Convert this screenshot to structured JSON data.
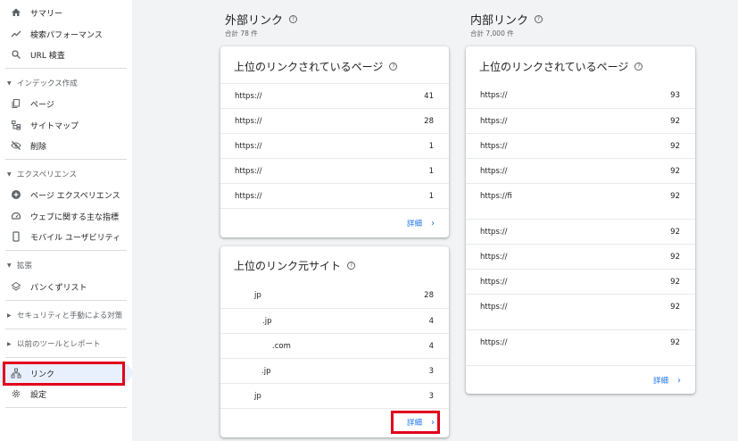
{
  "sidebar": {
    "items": [
      {
        "label": "サマリー",
        "icon": "home-icon"
      },
      {
        "label": "検索パフォーマンス",
        "icon": "trending-up-icon"
      },
      {
        "label": "URL 検査",
        "icon": "search-icon"
      }
    ],
    "index_section": "インデックス作成",
    "index_items": [
      {
        "label": "ページ",
        "icon": "pages-icon"
      },
      {
        "label": "サイトマップ",
        "icon": "sitemap-icon"
      },
      {
        "label": "削除",
        "icon": "eye-off-icon"
      }
    ],
    "experience_section": "エクスペリエンス",
    "experience_items": [
      {
        "label": "ページ エクスペリエンス",
        "icon": "add-circle-icon"
      },
      {
        "label": "ウェブに関する主な指標",
        "icon": "speed-icon"
      },
      {
        "label": "モバイル ユーザビリティ",
        "icon": "phone-icon"
      }
    ],
    "enhance_section": "拡張",
    "enhance_items": [
      {
        "label": "パンくずリスト",
        "icon": "layers-icon"
      }
    ],
    "security_section": "セキュリティと手動による対策",
    "legacy_section": "以前のツールとレポート",
    "links_label": "リンク",
    "settings_label": "設定"
  },
  "external": {
    "title": "外部リンク",
    "total": "合計 78 件",
    "top_pages": {
      "title": "上位のリンクされているページ",
      "rows": [
        {
          "url": "https://",
          "count": "41"
        },
        {
          "url": "https://",
          "count": "28"
        },
        {
          "url": "https://",
          "count": "1"
        },
        {
          "url": "https://",
          "count": "1"
        },
        {
          "url": "https://",
          "count": "1"
        }
      ],
      "detail": "詳細"
    },
    "top_sites": {
      "title": "上位のリンク元サイト",
      "rows": [
        {
          "url": "jp",
          "count": "28"
        },
        {
          "url": ".jp",
          "count": "4"
        },
        {
          "url": ".com",
          "count": "4"
        },
        {
          "url": ".jp",
          "count": "3"
        },
        {
          "url": "jp",
          "count": "3"
        }
      ],
      "detail": "詳細"
    }
  },
  "internal": {
    "title": "内部リンク",
    "total": "合計 7,000 件",
    "top_pages": {
      "title": "上位のリンクされているページ",
      "rows": [
        {
          "url": "https://",
          "count": "93"
        },
        {
          "url": "https://",
          "count": "92"
        },
        {
          "url": "https://",
          "count": "92"
        },
        {
          "url": "https://",
          "count": "92"
        },
        {
          "url": "https://fi",
          "count": "92"
        },
        {
          "url": "https://",
          "count": "92"
        },
        {
          "url": "https://",
          "count": "92"
        },
        {
          "url": "https://",
          "count": "92"
        },
        {
          "url": "https://",
          "count": "92"
        },
        {
          "url": "https://",
          "count": "92"
        }
      ],
      "detail": "詳細"
    }
  },
  "help_glyph": "?",
  "chevron_glyph": "›",
  "colors": {
    "accent": "#1a73e8",
    "highlight": "#e0001b",
    "active_bg": "#e8f0fe"
  }
}
